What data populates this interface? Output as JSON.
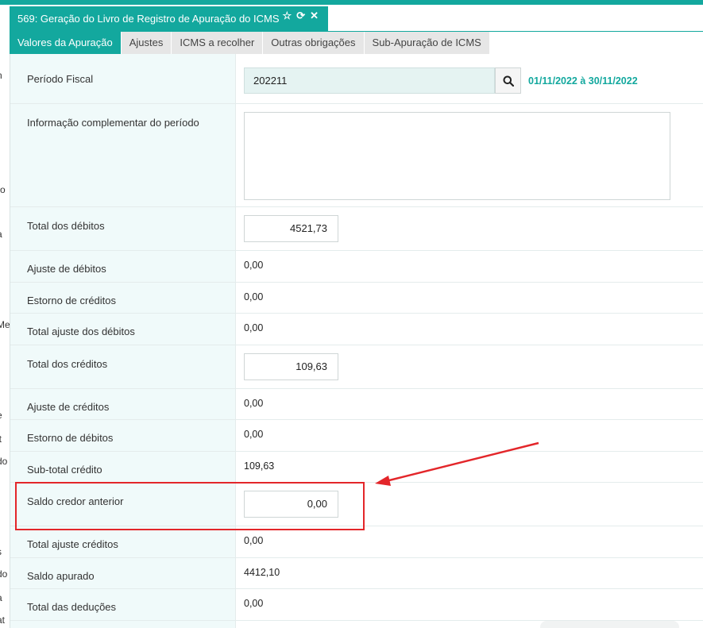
{
  "window": {
    "title": "569: Geração do Livro de Registro de Apuração do ICMS",
    "icons": {
      "favorite": "☆",
      "refresh": "⟳",
      "close": "✕"
    }
  },
  "tabs": [
    {
      "label": "Valores da Apuração",
      "active": true
    },
    {
      "label": "Ajustes",
      "active": false
    },
    {
      "label": "ICMS a recolher",
      "active": false
    },
    {
      "label": "Outras obrigações",
      "active": false
    },
    {
      "label": "Sub-Apuração de ICMS",
      "active": false
    }
  ],
  "form": {
    "periodo_fiscal": {
      "label": "Período Fiscal",
      "value": "202211",
      "range": "01/11/2022 à 30/11/2022"
    },
    "info_complementar": {
      "label": "Informação complementar do período",
      "value": ""
    },
    "total_debitos": {
      "label": "Total dos débitos",
      "value": "4521,73"
    },
    "ajuste_debitos": {
      "label": "Ajuste de débitos",
      "value": "0,00"
    },
    "estorno_creditos": {
      "label": "Estorno de créditos",
      "value": "0,00"
    },
    "total_ajuste_debitos": {
      "label": "Total ajuste dos débitos",
      "value": "0,00"
    },
    "total_creditos": {
      "label": "Total dos créditos",
      "value": "109,63"
    },
    "ajuste_creditos": {
      "label": "Ajuste de créditos",
      "value": "0,00"
    },
    "estorno_debitos": {
      "label": "Estorno de débitos",
      "value": "0,00"
    },
    "subtotal_credito": {
      "label": "Sub-total crédito",
      "value": "109,63"
    },
    "saldo_credor_anterior": {
      "label": "Saldo credor anterior",
      "value": "0,00"
    },
    "total_ajuste_creditos": {
      "label": "Total ajuste créditos",
      "value": "0,00"
    },
    "saldo_apurado": {
      "label": "Saldo apurado",
      "value": "4412,10"
    },
    "total_deducoes": {
      "label": "Total das deduções",
      "value": "0,00"
    }
  },
  "left_panel_fragments": [
    "n",
    "ro",
    "a",
    "Me",
    "e",
    "lt",
    "do",
    "s",
    "do",
    "a",
    "at"
  ],
  "colors": {
    "accent": "#13a89e",
    "annotation": "#e3262a"
  },
  "icons": [
    "search-icon",
    "star-icon",
    "refresh-icon",
    "close-icon"
  ]
}
